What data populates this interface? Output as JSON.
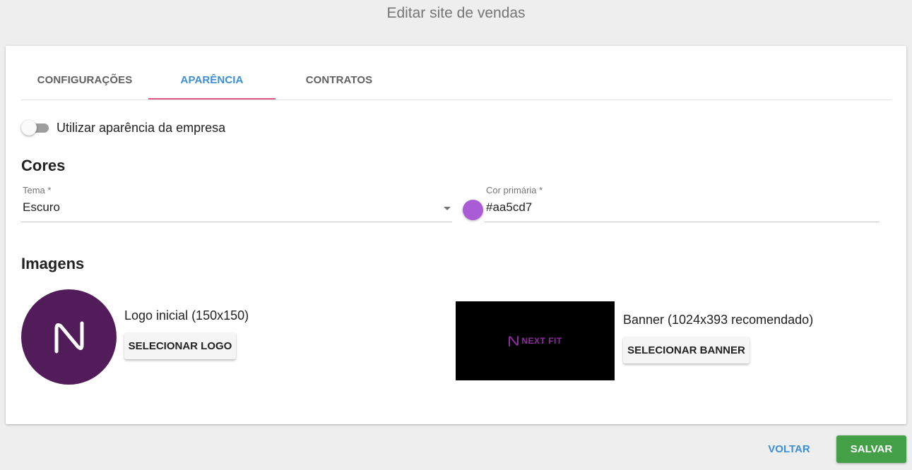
{
  "page": {
    "title": "Editar site de vendas"
  },
  "tabs": [
    {
      "label": "CONFIGURAÇÕES",
      "active": false
    },
    {
      "label": "APARÊNCIA",
      "active": true
    },
    {
      "label": "CONTRATOS",
      "active": false
    }
  ],
  "toggle": {
    "label": "Utilizar aparência da empresa",
    "checked": false
  },
  "cores": {
    "title": "Cores",
    "tema": {
      "label": "Tema *",
      "value": "Escuro"
    },
    "cor_primaria": {
      "label": "Cor primária *",
      "value": "#aa5cd7",
      "swatch_color": "#aa5cd7"
    }
  },
  "imagens": {
    "title": "Imagens",
    "logo": {
      "label": "Logo inicial (150x150)",
      "button": "SELECIONAR LOGO",
      "bg_color": "#521c5a",
      "icon": "nextfit-n-logo-icon"
    },
    "banner": {
      "label": "Banner (1024x393 recomendado)",
      "button": "SELECIONAR BANNER",
      "brand_text": "NEXT FIT",
      "brand_color": "#8e2ba0"
    }
  },
  "footer": {
    "back_label": "VOLTAR",
    "save_label": "SALVAR"
  },
  "colors": {
    "accent_tab": "#3a8fd6",
    "tab_indicator": "#e05a87",
    "save_button": "#43a047"
  }
}
